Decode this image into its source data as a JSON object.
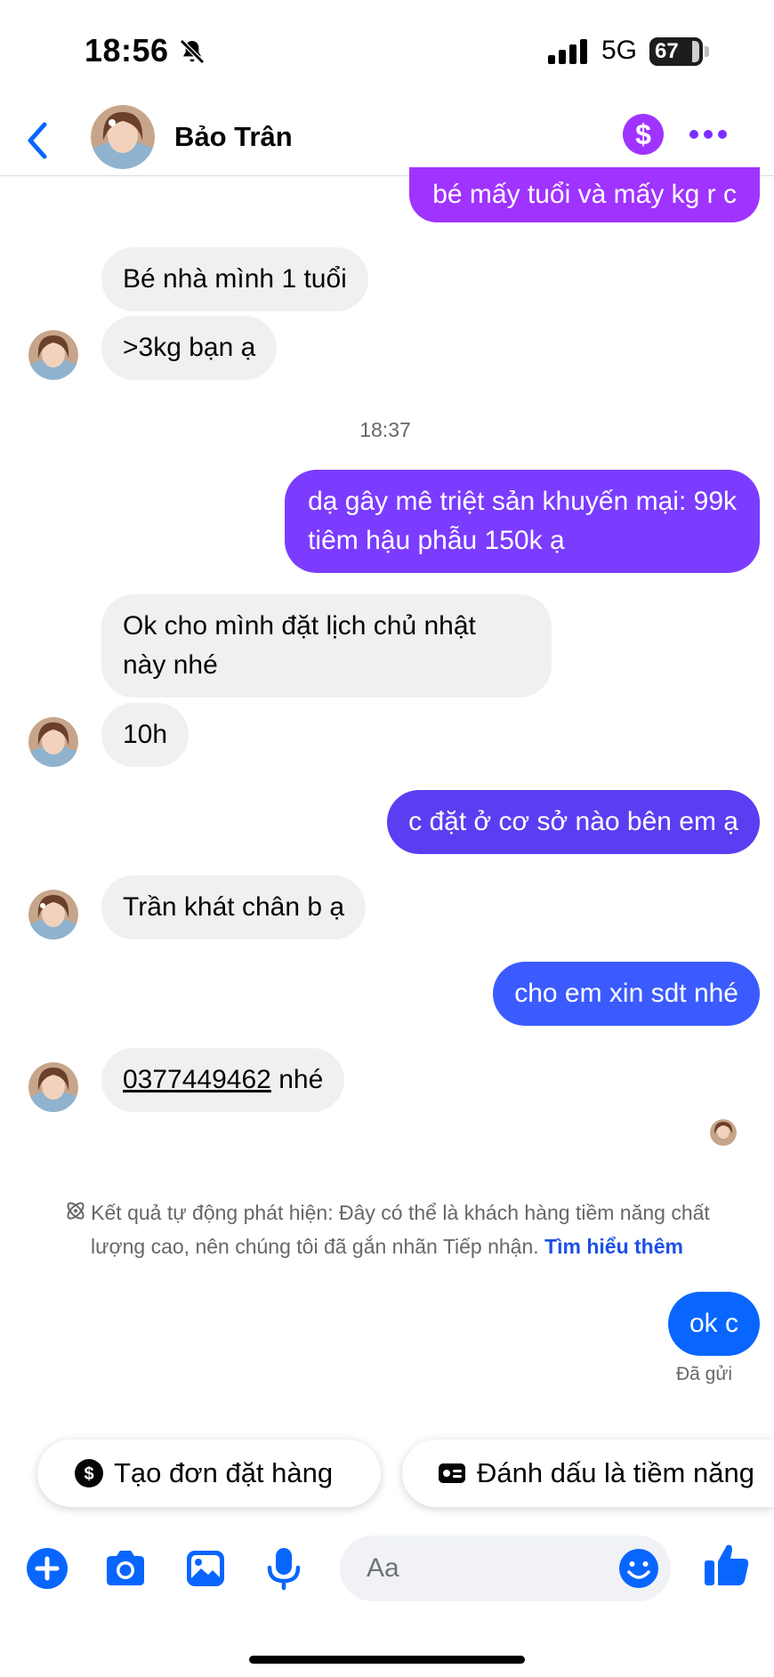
{
  "status_bar": {
    "time": "18:56",
    "network": "5G",
    "battery": "67"
  },
  "header": {
    "contact_name": "Bảo Trân",
    "money_symbol": "$"
  },
  "colors": {
    "accent": "#0866ff",
    "outgoing_purple": "#a033ff",
    "outgoing_violet": "#7b3cff",
    "outgoing_indigo": "#5a3ef2",
    "outgoing_blue": "#3b5bff",
    "incoming_bg": "#f0f0f0"
  },
  "messages": [
    {
      "direction": "out",
      "text": "bé mấy tuổi và mấy kg r c"
    },
    {
      "direction": "in",
      "text": "Bé nhà mình 1 tuổi"
    },
    {
      "direction": "in",
      "text": ">3kg bạn ạ"
    },
    {
      "timestamp": "18:37"
    },
    {
      "direction": "out",
      "line1": "dạ gây mê triệt sản khuyến mại: 99k",
      "line2": "tiêm hậu phẫu 150k ạ"
    },
    {
      "direction": "in",
      "line1": "Ok cho mình đặt lịch chủ nhật",
      "line2": "này nhé"
    },
    {
      "direction": "in",
      "text": "10h"
    },
    {
      "direction": "out",
      "text": "c đặt ở cơ sở nào bên em ạ"
    },
    {
      "direction": "in",
      "text": "Trần khát chân b ạ"
    },
    {
      "direction": "out",
      "text": "cho em xin sdt nhé"
    },
    {
      "direction": "in",
      "phone": "0377449462",
      "suffix": " nhé"
    },
    {
      "direction": "out",
      "text": "ok c"
    }
  ],
  "notice": {
    "text": "Kết quả tự động phát hiện: Đây có thể là khách hàng tiềm năng chất lượng cao, nên chúng tôi đã gắn nhãn Tiếp nhận.",
    "link": "Tìm hiểu thêm"
  },
  "sent_status": "Đã gửi",
  "quick_actions": [
    {
      "label": "Tạo đơn đặt hàng",
      "icon": "dollar-circle-icon"
    },
    {
      "label": "Đánh dấu là tiềm năng",
      "icon": "id-card-icon"
    }
  ],
  "composer": {
    "placeholder": "Aa",
    "value": ""
  }
}
